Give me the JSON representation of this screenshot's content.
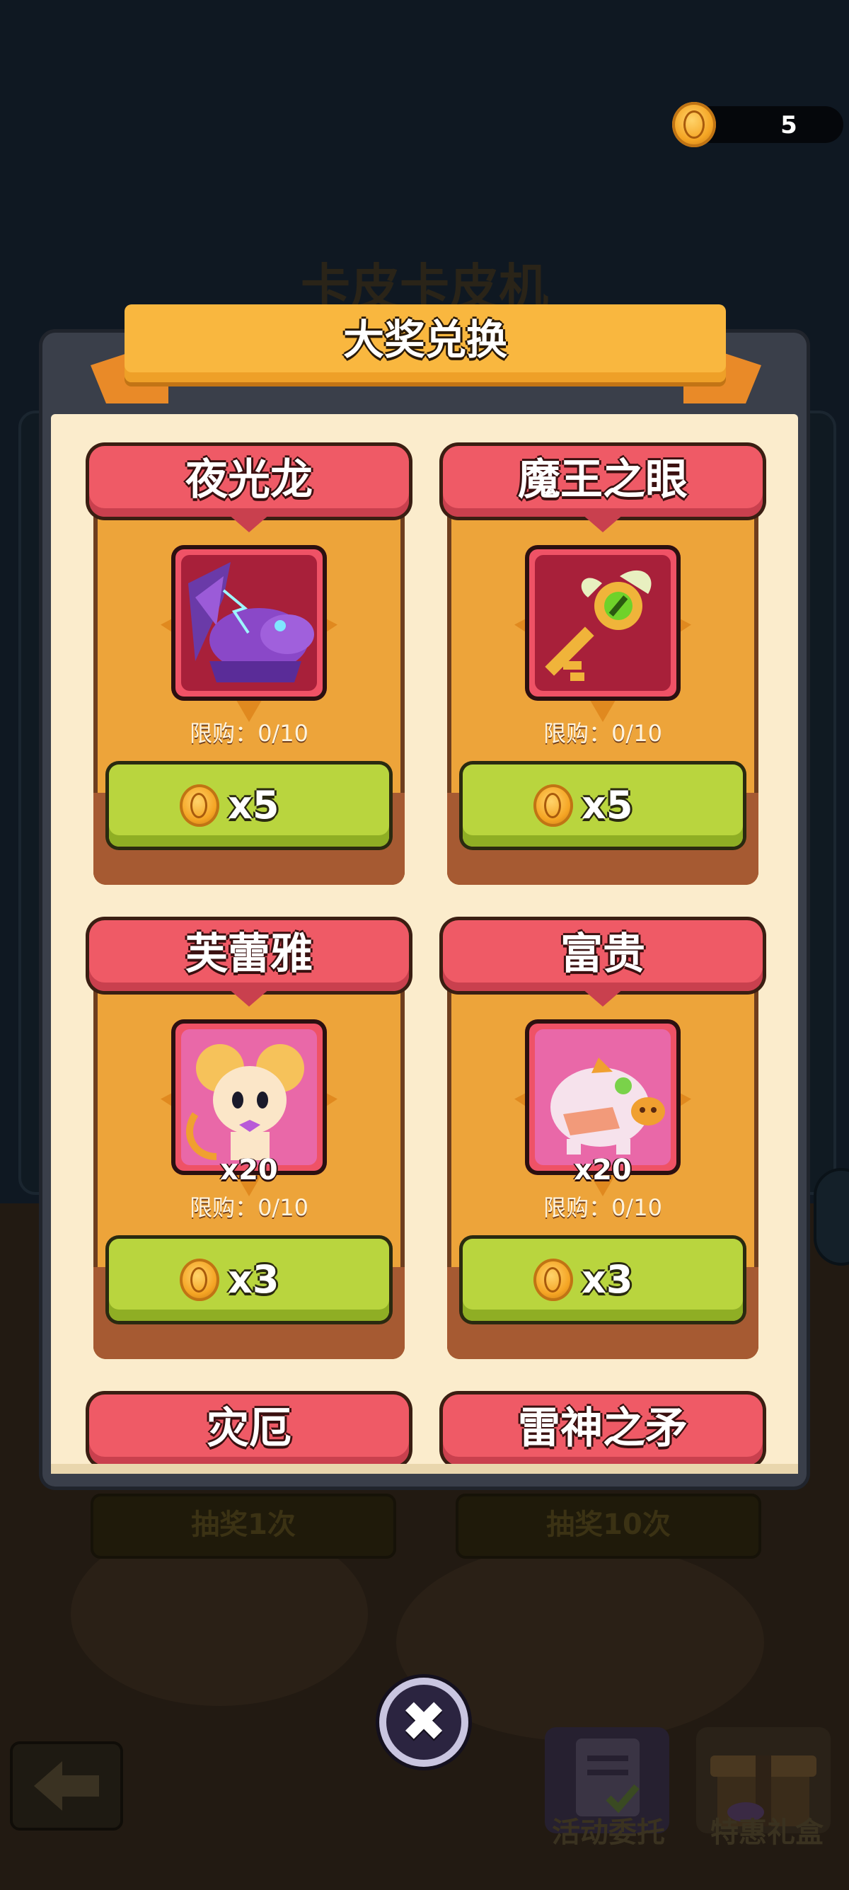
{
  "header": {
    "coin_count": "5",
    "background_title": "卡皮卡皮机"
  },
  "dialog": {
    "title": "大奖兑换",
    "items": [
      {
        "name": "夜光龙",
        "limit": "限购：0/10",
        "price": "x5",
        "quantity": ""
      },
      {
        "name": "魔王之眼",
        "limit": "限购：0/10",
        "price": "x5",
        "quantity": ""
      },
      {
        "name": "芙蕾雅",
        "limit": "限购：0/10",
        "price": "x3",
        "quantity": "x20"
      },
      {
        "name": "富贵",
        "limit": "限购：0/10",
        "price": "x3",
        "quantity": "x20"
      },
      {
        "name": "灾厄",
        "limit": "",
        "price": "",
        "quantity": ""
      },
      {
        "name": "雷神之矛",
        "limit": "",
        "price": "",
        "quantity": ""
      }
    ]
  },
  "background_buttons": {
    "draw_once": "抽奖1次",
    "draw_ten": "抽奖10次"
  },
  "dock": {
    "activity_label": "活动委托",
    "gift_label": "特惠礼盒"
  },
  "colors": {
    "banner": "#ef5a66",
    "card": "#eda43a",
    "button": "#b9d53e",
    "ribbon": "#f9b73f"
  }
}
